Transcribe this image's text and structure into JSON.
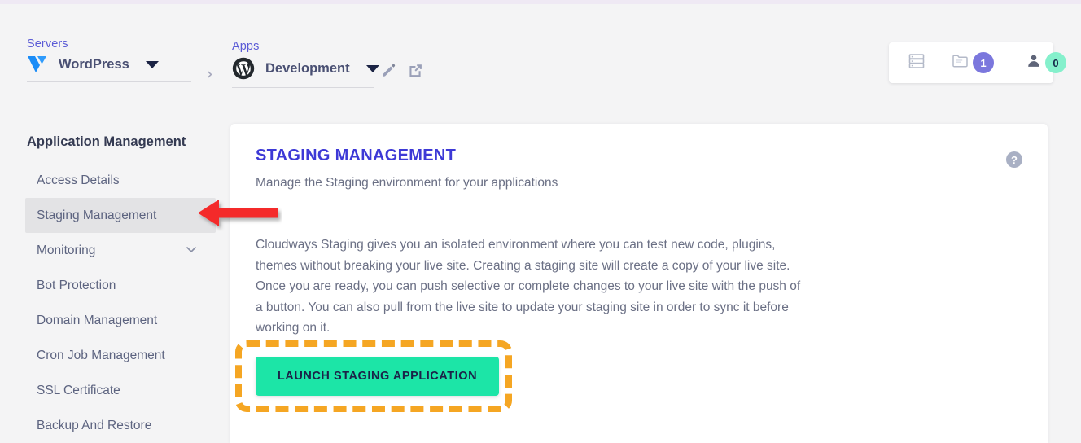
{
  "topbar": {
    "servers": {
      "label": "Servers",
      "value": "WordPress",
      "logo_icon": "vultr-logo-icon",
      "caret_icon": "chevron-down-icon"
    },
    "separator_icon": "chevron-right-icon",
    "apps": {
      "label": "Apps",
      "value": "Development",
      "logo_icon": "wordpress-logo-icon",
      "caret_icon": "chevron-down-icon"
    },
    "actions": [
      {
        "icon": "pencil-edit-icon"
      },
      {
        "icon": "external-link-icon"
      }
    ]
  },
  "stats": {
    "items": [
      {
        "name": "servers",
        "icon": "server-rack-icon",
        "count": ""
      },
      {
        "name": "apps",
        "icon": "folder-icon",
        "count": "1"
      },
      {
        "name": "users",
        "icon": "user-icon",
        "count": "0"
      }
    ]
  },
  "sidebar": {
    "title": "Application Management",
    "items": [
      {
        "label": "Access Details",
        "active": false,
        "expandable": false
      },
      {
        "label": "Staging Management",
        "active": true,
        "expandable": false
      },
      {
        "label": "Monitoring",
        "active": false,
        "expandable": true,
        "chevron": "⌄"
      },
      {
        "label": "Bot Protection",
        "active": false,
        "expandable": false
      },
      {
        "label": "Domain Management",
        "active": false,
        "expandable": false
      },
      {
        "label": "Cron Job Management",
        "active": false,
        "expandable": false
      },
      {
        "label": "SSL Certificate",
        "active": false,
        "expandable": false
      },
      {
        "label": "Backup And Restore",
        "active": false,
        "expandable": false
      }
    ]
  },
  "main": {
    "title": "STAGING MANAGEMENT",
    "subtitle": "Manage the Staging environment for your applications",
    "help_icon": "question-mark-icon",
    "help_glyph": "?",
    "body": "Cloudways Staging gives you an isolated environment where you can test new code, plugins, themes without breaking your live site. Creating a staging site will create a copy of your live site. Once you are ready, you can push selective or complete changes to your live site with the push of a button. You can also pull from the live site to update your staging site in order to sync it before working on it.",
    "cta_label": "LAUNCH STAGING APPLICATION"
  },
  "annotations": {
    "arrow_icon": "red-left-arrow-icon",
    "highlight_icon": "orange-dashed-highlight"
  },
  "colors": {
    "page_bg": "#f4f4f5",
    "accent_blue": "#3d39d6",
    "link_purple": "#5b5bd6",
    "cta_green": "#1ce5a7",
    "cta_text": "#1b2248",
    "highlight_orange": "#f5a623",
    "arrow_red": "#f42c2c",
    "badge_apps": "#7b77dd",
    "badge_users": "#85f0cc",
    "active_nav_bg": "#e3e3e5"
  }
}
